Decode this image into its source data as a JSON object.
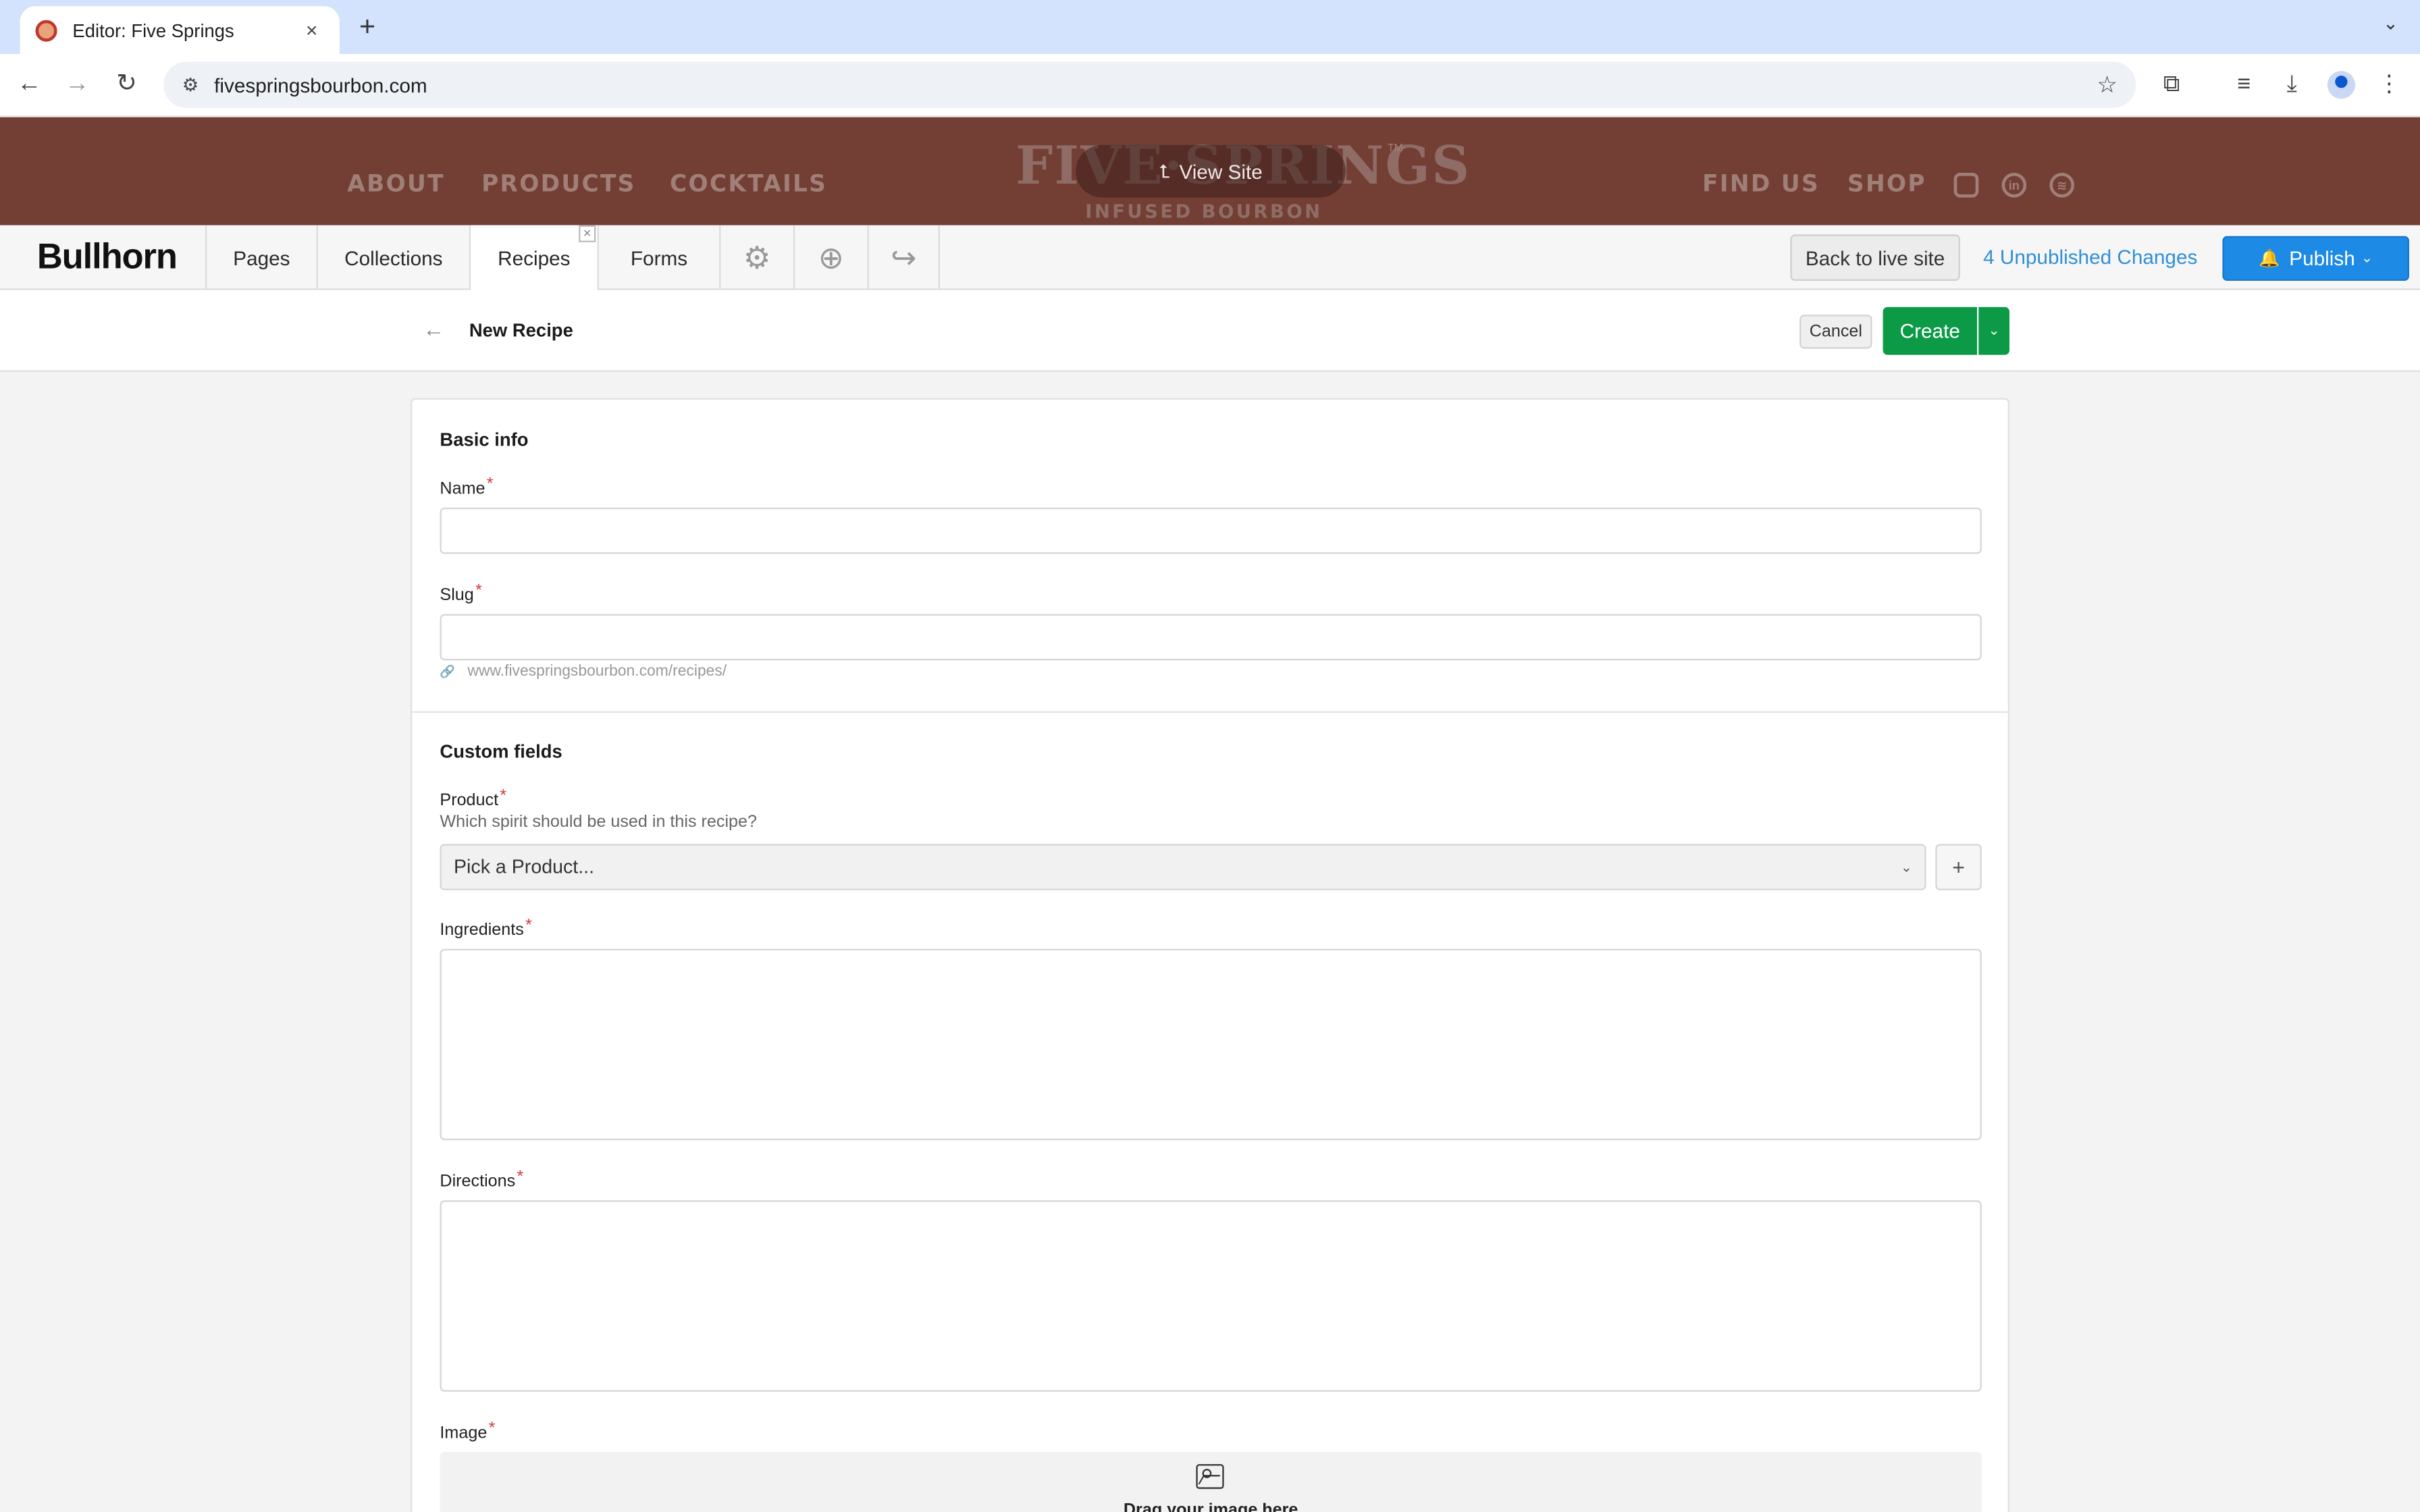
{
  "browser": {
    "tab_title": "Editor: Five Springs",
    "url": "fivespringsbourbon.com",
    "new_tab_glyph": "+",
    "close_glyph": "×"
  },
  "site": {
    "nav_left": [
      "ABOUT",
      "PRODUCTS",
      "COCKTAILS"
    ],
    "nav_right": [
      "FIND US",
      "SHOP"
    ],
    "logo_main": "FIVE·SPRINGS",
    "logo_sub": "INFUSED BOURBON",
    "logo_tm": "TM",
    "view_site_label": "View Site",
    "social_icons": [
      "instagram-icon",
      "linkedin-icon",
      "spotify-icon"
    ],
    "brand_color": "#733f35"
  },
  "editor": {
    "brand": "Bullhorn",
    "tabs": [
      "Pages",
      "Collections",
      "Recipes",
      "Forms"
    ],
    "active_tab": "Recipes",
    "icon_tabs": [
      "gear-icon",
      "help-icon",
      "share-icon"
    ],
    "back_to_live": "Back to live site",
    "unpublished": "4 Unpublished Changes",
    "publish_label": "Publish",
    "accent_color": "#1d8ae6"
  },
  "subheader": {
    "title": "New Recipe",
    "cancel_label": "Cancel",
    "create_label": "Create",
    "create_color": "#0c9a47"
  },
  "form": {
    "basic_info_title": "Basic info",
    "name_label": "Name",
    "name_value": "",
    "slug_label": "Slug",
    "slug_value": "",
    "slug_hint": "www.fivespringsbourbon.com/recipes/",
    "custom_fields_title": "Custom fields",
    "product_label": "Product",
    "product_help": "Which spirit should be used in this recipe?",
    "product_placeholder": "Pick a Product...",
    "ingredients_label": "Ingredients",
    "directions_label": "Directions",
    "image_label": "Image",
    "image_drop_text": "Drag your image here",
    "required_mark": "*"
  }
}
